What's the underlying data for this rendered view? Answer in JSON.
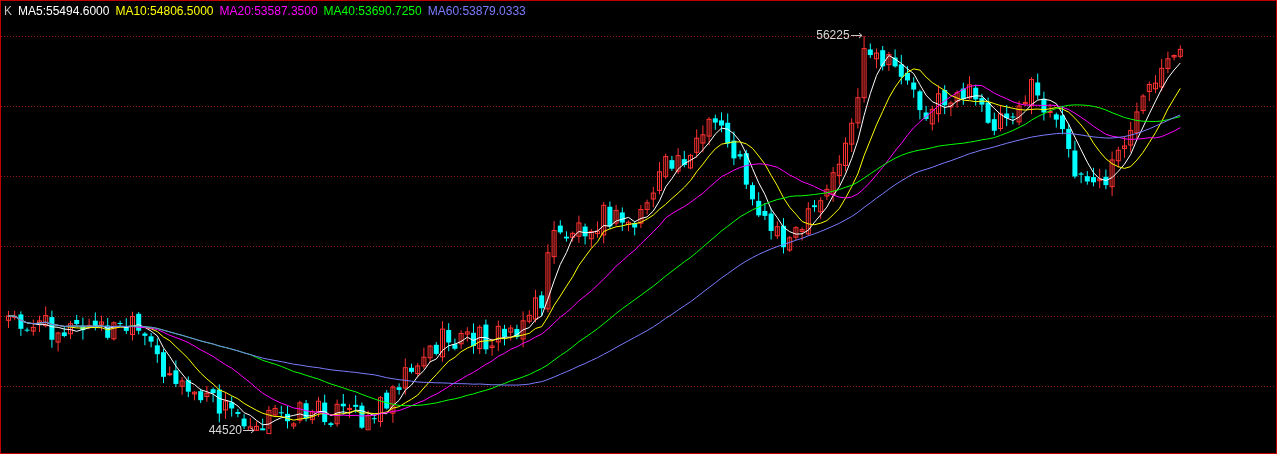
{
  "chart": {
    "period_label": "K",
    "legend": [
      {
        "text": "MA5:55494.6000",
        "color": "#ffffff"
      },
      {
        "text": "MA10:54806.5000",
        "color": "#ffff00"
      },
      {
        "text": "MA20:53587.3500",
        "color": "#ff00ff"
      },
      {
        "text": "MA40:53690.7250",
        "color": "#00ff00"
      },
      {
        "text": "MA60:53879.0333",
        "color": "#7b7bff"
      }
    ],
    "high_label": "56225",
    "low_label": "44520"
  }
}
